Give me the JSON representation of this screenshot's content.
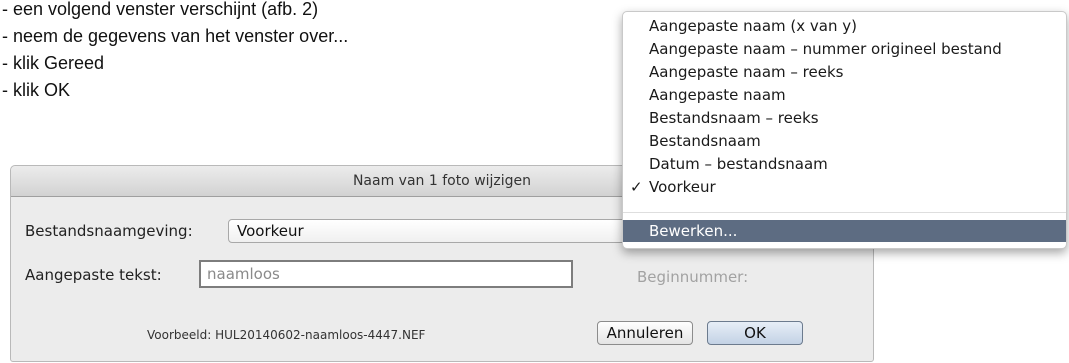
{
  "instructions": [
    "- een volgend venster verschijnt (afb. 2)",
    "- neem de gegevens van het venster over...",
    "- klik Gereed",
    "- klik OK"
  ],
  "dialog": {
    "title": "Naam van 1 foto wijzigen",
    "filename_label": "Bestandsnaamgeving:",
    "filename_value": "Voorkeur",
    "custom_text_label": "Aangepaste tekst:",
    "custom_text_placeholder": "naamloos",
    "start_number_label": "Beginnummer:",
    "preview_label": "Voorbeeld:",
    "preview_value": "HUL20140602-naamloos-4447.NEF",
    "cancel_label": "Annuleren",
    "ok_label": "OK"
  },
  "menu": {
    "items": [
      "Aangepaste naam (x van y)",
      "Aangepaste naam – nummer origineel bestand",
      "Aangepaste naam – reeks",
      "Aangepaste naam",
      "Bestandsnaam – reeks",
      "Bestandsnaam",
      "Datum – bestandsnaam",
      "Voorkeur"
    ],
    "checked_mark": "✓",
    "edit_label": "Bewerken..."
  }
}
